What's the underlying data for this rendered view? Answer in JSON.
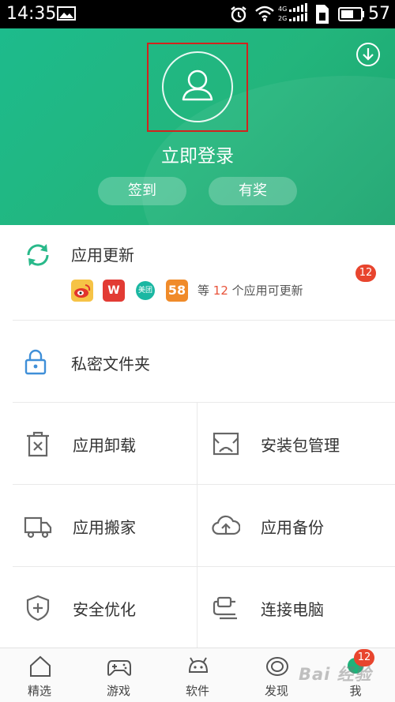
{
  "status_bar": {
    "time": "14:35",
    "battery_level": "57",
    "network": "4G 2G"
  },
  "header": {
    "login_label": "立即登录",
    "checkin_label": "签到",
    "reward_label": "有奖",
    "background_color": "#1dbb8c"
  },
  "app_update": {
    "title": "应用更新",
    "desc_prefix": "等",
    "desc_count": "12",
    "desc_suffix": "个应用可更新",
    "badge": "12",
    "apps": [
      "weibo",
      "WPS",
      "美团",
      "58"
    ]
  },
  "private_folder": {
    "title": "私密文件夹"
  },
  "grid": [
    {
      "label": "应用卸载",
      "icon": "trash-icon"
    },
    {
      "label": "安装包管理",
      "icon": "package-icon"
    },
    {
      "label": "应用搬家",
      "icon": "truck-icon"
    },
    {
      "label": "应用备份",
      "icon": "cloud-upload-icon"
    },
    {
      "label": "安全优化",
      "icon": "shield-icon"
    },
    {
      "label": "连接电脑",
      "icon": "usb-cable-icon"
    }
  ],
  "nav": {
    "items": [
      {
        "label": "精选",
        "icon": "home-icon"
      },
      {
        "label": "游戏",
        "icon": "gamepad-icon"
      },
      {
        "label": "软件",
        "icon": "android-icon"
      },
      {
        "label": "发现",
        "icon": "eye-icon"
      },
      {
        "label": "我",
        "icon": "profile-icon"
      }
    ],
    "badge": "12"
  },
  "watermark": "Bai 经验",
  "colors": {
    "accent": "#1fb27a",
    "badge": "#e8452e",
    "highlight_frame": "#d2231d"
  }
}
